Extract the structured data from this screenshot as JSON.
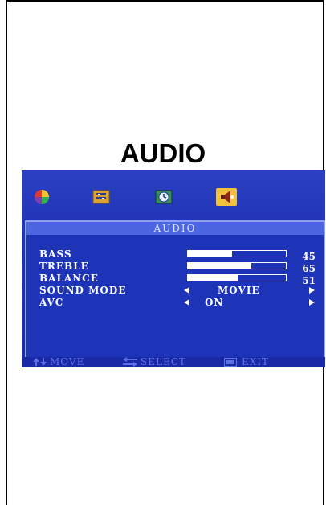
{
  "page": {
    "title": "AUDIO"
  },
  "osd": {
    "icons": [
      {
        "name": "picture-icon"
      },
      {
        "name": "setup-icon"
      },
      {
        "name": "clock-icon"
      },
      {
        "name": "speaker-icon"
      }
    ],
    "panel_title": "AUDIO",
    "sliders": [
      {
        "label": "BASS",
        "value": "45",
        "level": 45
      },
      {
        "label": "TREBLE",
        "value": "65",
        "level": 65
      },
      {
        "label": "BALANCE",
        "value": "51",
        "level": 51
      }
    ],
    "options": [
      {
        "label": "SOUND MODE",
        "value": "MOVIE"
      },
      {
        "label": "AVC",
        "value": "ON"
      }
    ],
    "footer": {
      "move_label": "MOVE",
      "select_label": "SELECT",
      "exit_label": "EXIT"
    }
  }
}
